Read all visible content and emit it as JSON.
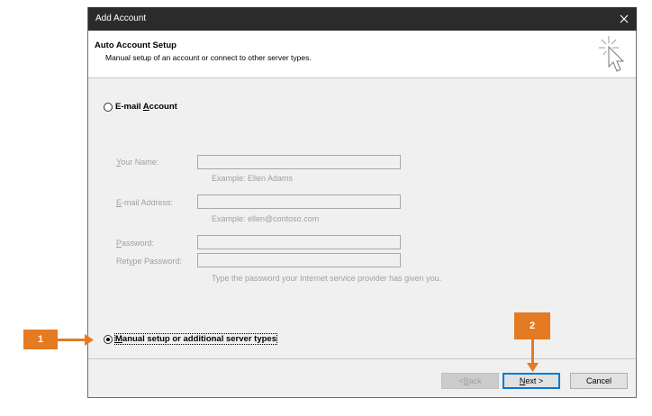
{
  "window": {
    "title": "Add Account",
    "close_glyph": "✕"
  },
  "header": {
    "title": "Auto Account Setup",
    "subtitle": "Manual setup of an account or connect to other server types.",
    "icon": "cursor-sparkle-icon"
  },
  "options": {
    "email_account": {
      "label_pre": "E-mail ",
      "label_accel": "A",
      "label_post": "ccount",
      "checked": false
    },
    "manual_setup": {
      "label_accel": "M",
      "label_post": "anual setup or additional server types",
      "checked": true
    }
  },
  "form": {
    "your_name": {
      "label_accel": "Y",
      "label_post": "our Name:",
      "value": "",
      "hint": "Example: Ellen Adams"
    },
    "email_address": {
      "label_accel": "E",
      "label_post": "-mail Address:",
      "value": "",
      "hint": "Example: ellen@contoso.com"
    },
    "password": {
      "label_accel": "P",
      "label_post": "assword:",
      "value": ""
    },
    "retype_password": {
      "label_pre": "Ret",
      "label_accel": "y",
      "label_post": "pe Password:",
      "value": ""
    },
    "password_hint": "Type the password your Internet service provider has given you."
  },
  "buttons": {
    "back": {
      "pre": "< ",
      "accel": "B",
      "post": "ack"
    },
    "next": {
      "accel": "N",
      "post": "ext >"
    },
    "cancel": "Cancel"
  },
  "callouts": {
    "first": "1",
    "second": "2"
  },
  "colors": {
    "titlebar": "#2b2b2b",
    "callout": "#e47a22",
    "focus": "#0078d7"
  }
}
